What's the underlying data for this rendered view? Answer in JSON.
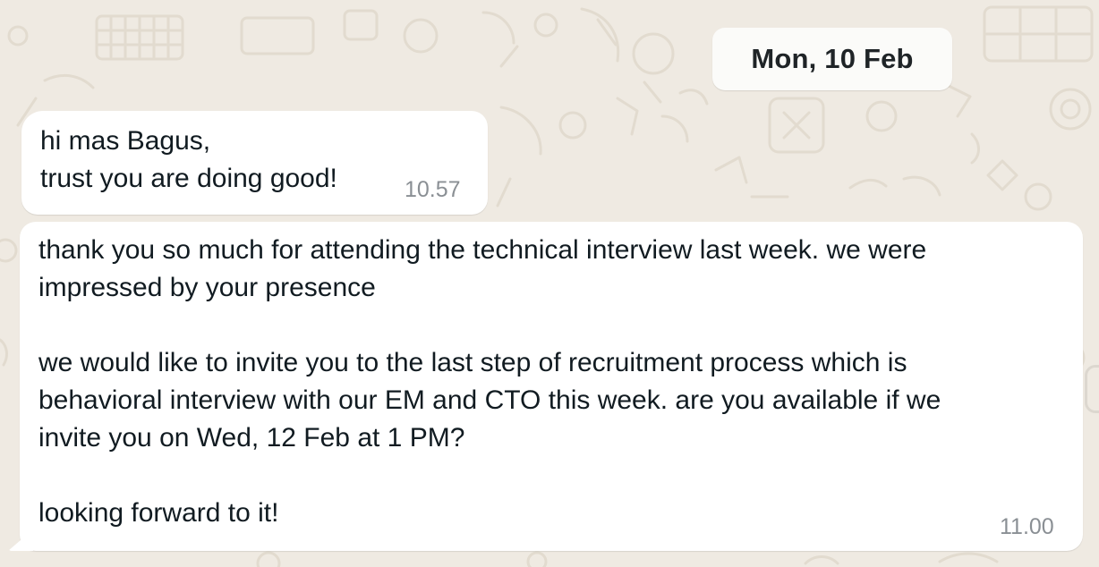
{
  "chat": {
    "date_separator": "Mon, 10 Feb",
    "messages": [
      {
        "lines": [
          "hi mas Bagus,",
          "trust you are doing good!"
        ],
        "time": "10.57"
      },
      {
        "lines": [
          "thank you so much for attending the technical interview last week. we were",
          "impressed by your presence",
          "",
          "we would like to invite you to the last step of recruitment process which is",
          "behavioral interview with our EM and CTO this week. are you available if we",
          "invite you on Wed, 12 Feb at 1 PM?",
          "",
          "looking forward to it!"
        ],
        "time": "11.00"
      }
    ]
  },
  "colors": {
    "background": "#efeae2",
    "bubble": "#ffffff",
    "text": "#111b21",
    "timestamp": "#8a8f94"
  }
}
